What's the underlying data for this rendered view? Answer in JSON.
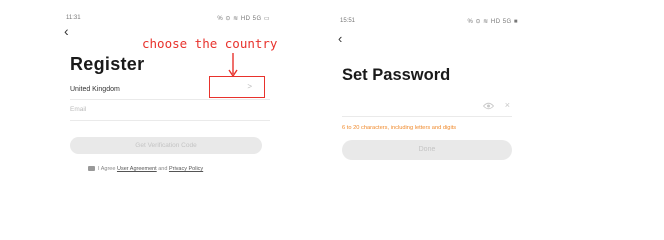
{
  "register_screen": {
    "status": {
      "time": "11:31",
      "icons": "% ⊙ ≋ HD 5G ▭"
    },
    "back_icon": "chevron-left-icon",
    "title": "Register",
    "annotation": "choose the country",
    "annotation_color": "#e8322c",
    "country_field": {
      "value": "United Kingdom",
      "chevron": ">"
    },
    "email_field": {
      "placeholder": "Email"
    },
    "send_code_button": "Get Verification Code",
    "agreement": {
      "prefix": "I Agree ",
      "user_agreement": "User Agreement",
      "connector": " and ",
      "privacy_policy": "Privacy Policy"
    }
  },
  "password_screen": {
    "status": {
      "time": "15:51",
      "icons": "% ⊙ ≋ HD 5G ■"
    },
    "back_icon": "chevron-left-icon",
    "title": "Set Password",
    "password_field": {
      "value": ""
    },
    "hint": "6 to 20 characters, including letters and digits",
    "hint_color": "#f08a2c",
    "done_button": "Done"
  }
}
